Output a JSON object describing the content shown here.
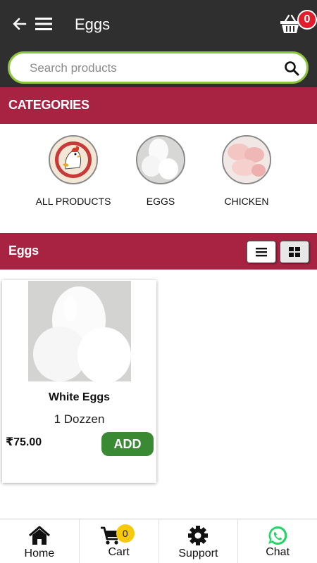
{
  "header": {
    "title": "Eggs",
    "back_icon": "arrow-left-icon",
    "menu_icon": "hamburger-menu-icon",
    "cart_icon": "basket-icon",
    "cart_count": "0"
  },
  "search": {
    "placeholder": "Search products",
    "value": ""
  },
  "categories": {
    "heading": "CATEGORIES",
    "items": [
      {
        "label": "ALL PRODUCTS"
      },
      {
        "label": "EGGS"
      },
      {
        "label": "CHICKEN"
      }
    ]
  },
  "products_section": {
    "heading": "Eggs",
    "view_list_icon": "list-view-icon",
    "view_grid_icon": "grid-view-icon"
  },
  "products": [
    {
      "name": "White Eggs",
      "quantity": "1 Dozzen",
      "price": "₹75.00",
      "add_label": "ADD"
    }
  ],
  "bottom_nav": {
    "items": [
      {
        "label": "Home",
        "icon": "home-icon"
      },
      {
        "label": "Cart",
        "icon": "cart-icon",
        "badge": "0"
      },
      {
        "label": "Support",
        "icon": "gear-icon"
      },
      {
        "label": "Chat",
        "icon": "whatsapp-icon"
      }
    ]
  },
  "colors": {
    "header_bg": "#2f2f2f",
    "accent_bar": "#a82242",
    "search_border": "#8cc63f",
    "add_button": "#3a8a34",
    "badge_red": "#e01e2b",
    "badge_yellow": "#f7c90c",
    "whatsapp": "#25d366"
  }
}
